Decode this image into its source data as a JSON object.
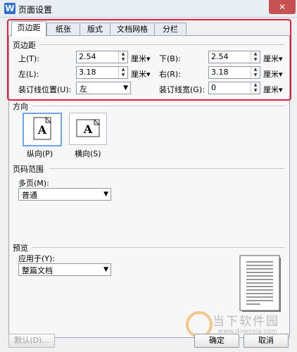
{
  "window": {
    "title": "页面设置",
    "app_icon_glyph": "W",
    "close_glyph": "✕"
  },
  "tabs": [
    {
      "label": "页边距",
      "active": true
    },
    {
      "label": "纸张",
      "active": false
    },
    {
      "label": "版式",
      "active": false
    },
    {
      "label": "文档网格",
      "active": false
    },
    {
      "label": "分栏",
      "active": false
    }
  ],
  "margins": {
    "heading": "页边距",
    "top_label": "上(T):",
    "top_value": "2.54",
    "bottom_label": "下(B):",
    "bottom_value": "2.54",
    "left_label": "左(L):",
    "left_value": "3.18",
    "right_label": "右(R):",
    "right_value": "3.18",
    "gutter_pos_label": "装订线位置(U):",
    "gutter_pos_value": "左",
    "gutter_label": "装订线宽(G):",
    "gutter_value": "0",
    "unit": "厘米"
  },
  "orientation": {
    "heading": "方向",
    "portrait_label": "纵向(P)",
    "landscape_label": "横向(S)",
    "glyph": "A",
    "selected": "portrait"
  },
  "page_range": {
    "heading": "页码范围",
    "multiple_label": "多页(M):",
    "multiple_value": "普通"
  },
  "preview": {
    "heading": "预览",
    "apply_label": "应用于(Y):",
    "apply_value": "整篇文档"
  },
  "buttons": {
    "default": "默认(D)...",
    "ok": "确定",
    "cancel": "取消"
  },
  "watermark": {
    "text": "当下软件园",
    "url": "www.downxia.com"
  },
  "colors": {
    "highlight": "#e0203a",
    "accent": "#2a6edb",
    "selected_border": "#6fa6e8"
  }
}
